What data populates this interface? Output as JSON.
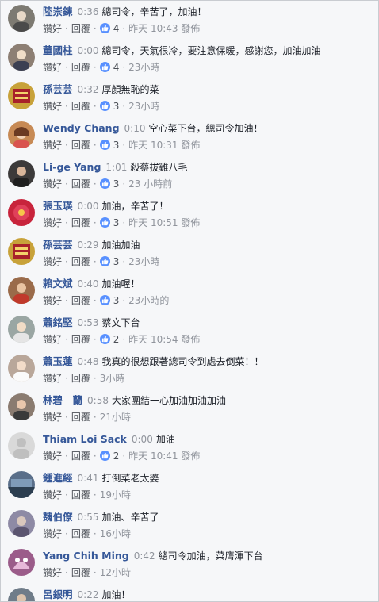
{
  "actions": {
    "like": "讚好",
    "reply": "回覆"
  },
  "comments": [
    {
      "author": "陸崇鍊",
      "ts": "0:36",
      "text": "總司令，辛苦了，加油！",
      "likes": "4",
      "time": "昨天 10:43 發佈",
      "avatar_color": "#7d7a72"
    },
    {
      "author": "董國柱",
      "ts": "0:00",
      "text": "總司令，天氣很冷，要注意保暖，感謝您，加油加油",
      "likes": "4",
      "time": "23小時",
      "avatar_color": "#8d7f74"
    },
    {
      "author": "孫芸芸",
      "ts": "0:32",
      "text": "厚顏無恥的菜",
      "likes": "3",
      "time": "23小時",
      "avatar_color": "#c8a23a"
    },
    {
      "author": "Wendy Chang",
      "ts": "0:10",
      "text": "空心菜下台，總司令加油！",
      "likes": "3",
      "time": "昨天 10:31 發佈",
      "avatar_color": "#c78a55"
    },
    {
      "author": "Li-ge Yang",
      "ts": "1:01",
      "text": "殺蔡拔雞八毛",
      "likes": "3",
      "time": "23 小時前",
      "avatar_color": "#3c3a3a"
    },
    {
      "author": "張玉瑛",
      "ts": "0:00",
      "text": "加油，辛苦了！",
      "likes": "3",
      "time": "昨天 10:51 發佈",
      "avatar_color": "#c8243c"
    },
    {
      "author": "孫芸芸",
      "ts": "0:29",
      "text": "加油加油",
      "likes": "3",
      "time": "23小時",
      "avatar_color": "#c8a23a"
    },
    {
      "author": "賴文斌",
      "ts": "0:40",
      "text": "加油喔！",
      "likes": "3",
      "time": "23小時的",
      "avatar_color": "#9a6b4a"
    },
    {
      "author": "蕭銘堅",
      "ts": "0:53",
      "text": "蔡文下台",
      "likes": "2",
      "time": "昨天 10:54 發佈",
      "avatar_color": "#9aa6a3"
    },
    {
      "author": "蕭玉蓮",
      "ts": "0:48",
      "text": "我真的很想跟著總司令到處去倒菜！！",
      "likes": "",
      "time": "3小時",
      "avatar_color": "#b9a79a"
    },
    {
      "author": "林碧　蘭",
      "ts": "0:58",
      "text": "大家團結一心加油加油加油",
      "likes": "",
      "time": "21小時",
      "avatar_color": "#8a7b70"
    },
    {
      "author": "Thiam Loi Sack",
      "ts": "0:00",
      "text": "加油",
      "likes": "2",
      "time": "昨天 10:41 發佈",
      "avatar_color": "#d9d9d9"
    },
    {
      "author": "鍾進經",
      "ts": "0:41",
      "text": "打倒菜老太婆",
      "likes": "",
      "time": "19小時",
      "avatar_color": "#5a6f8a"
    },
    {
      "author": "魏伯僚",
      "ts": "0:55",
      "text": "加油、辛苦了",
      "likes": "",
      "time": "16小時",
      "avatar_color": "#8e8aa5"
    },
    {
      "author": "Yang Chih Ming",
      "ts": "0:42",
      "text": "總司令加油，菜膺渾下台",
      "likes": "",
      "time": "12小時",
      "avatar_color": "#9b5c8a"
    },
    {
      "author": "呂銀明",
      "ts": "0:22",
      "text": "加油！",
      "likes": "",
      "time": "",
      "avatar_color": "#6f7c89"
    }
  ]
}
